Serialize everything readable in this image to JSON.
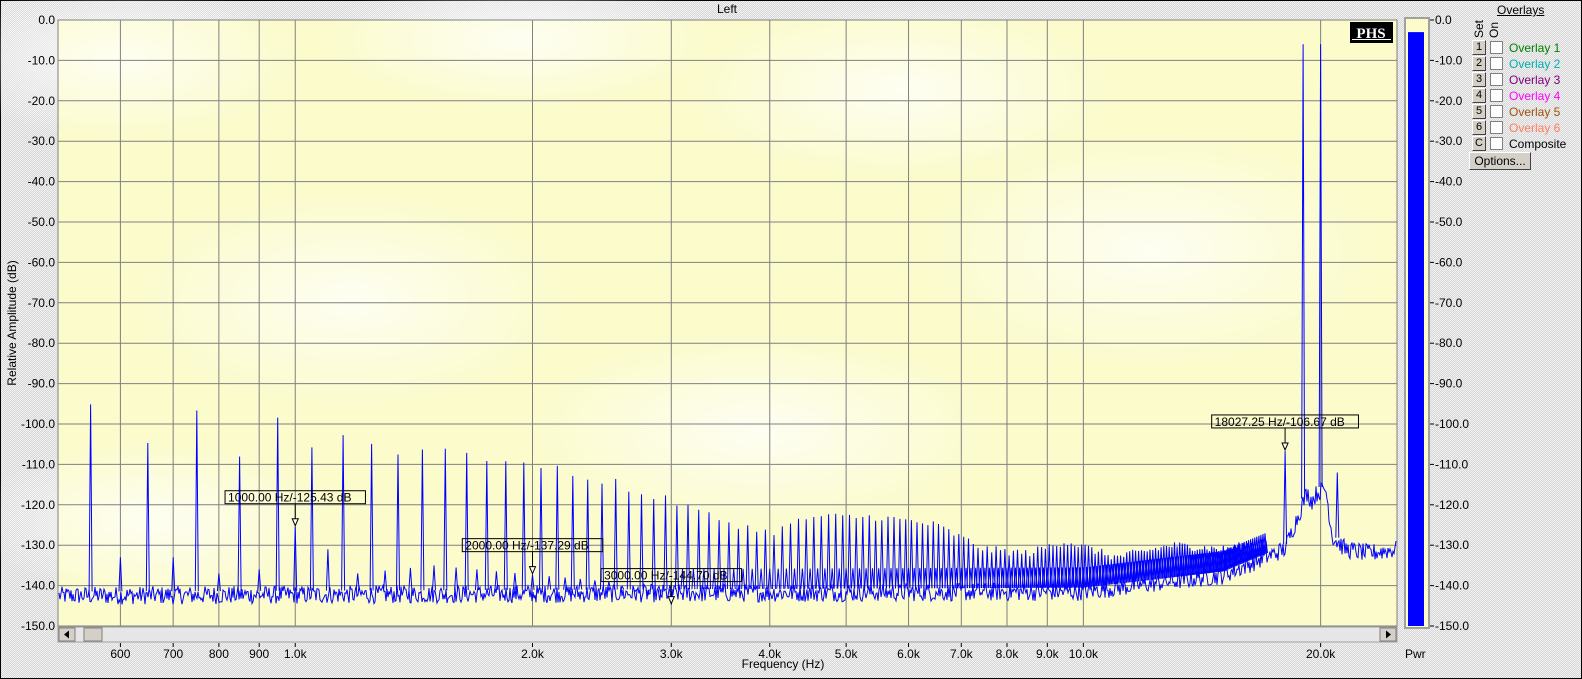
{
  "chart_data": {
    "type": "line",
    "title": "Left",
    "xlabel": "Frequency (Hz)",
    "ylabel": "Relative Amplitude (dB)",
    "xscale": "log",
    "xlim": [
      500,
      25000
    ],
    "ylim": [
      -150,
      0
    ],
    "grid": true,
    "x_ticks": [
      {
        "value": 600,
        "label": "600"
      },
      {
        "value": 700,
        "label": "700"
      },
      {
        "value": 800,
        "label": "800"
      },
      {
        "value": 900,
        "label": "900"
      },
      {
        "value": 1000,
        "label": "1.0k"
      },
      {
        "value": 2000,
        "label": "2.0k"
      },
      {
        "value": 3000,
        "label": "3.0k"
      },
      {
        "value": 4000,
        "label": "4.0k"
      },
      {
        "value": 5000,
        "label": "5.0k"
      },
      {
        "value": 6000,
        "label": "6.0k"
      },
      {
        "value": 7000,
        "label": "7.0k"
      },
      {
        "value": 8000,
        "label": "8.0k"
      },
      {
        "value": 9000,
        "label": "9.0k"
      },
      {
        "value": 10000,
        "label": "10.0k"
      },
      {
        "value": 20000,
        "label": "20.0k"
      }
    ],
    "y_ticks": [
      0,
      -10,
      -20,
      -30,
      -40,
      -50,
      -60,
      -70,
      -80,
      -90,
      -100,
      -110,
      -120,
      -130,
      -140,
      -150
    ],
    "y_tick_labels": [
      "0.0",
      "-10.0",
      "-20.0",
      "-30.0",
      "-40.0",
      "-50.0",
      "-60.0",
      "-70.0",
      "-80.0",
      "-90.0",
      "-100.0",
      "-110.0",
      "-120.0",
      "-130.0",
      "-140.0",
      "-150.0"
    ],
    "series_color": "#0000ff",
    "tones": [
      [
        19000,
        -6.0
      ],
      [
        20000,
        -6.0
      ]
    ],
    "main_comb": {
      "start": 550,
      "step": 100,
      "end": 17050,
      "envelope": [
        [
          550,
          -94.5
        ],
        [
          650,
          -104
        ],
        [
          750,
          -97
        ],
        [
          850,
          -108
        ],
        [
          950,
          -99.4
        ],
        [
          1050,
          -105.5
        ],
        [
          1150,
          -102
        ],
        [
          1250,
          -105.6
        ],
        [
          1350,
          -106.7
        ],
        [
          1450,
          -105.7
        ],
        [
          1550,
          -107
        ],
        [
          1650,
          -106.5
        ],
        [
          1750,
          -109
        ],
        [
          1850,
          -110
        ],
        [
          1950,
          -110
        ],
        [
          2050,
          -110
        ],
        [
          2150,
          -111
        ],
        [
          2250,
          -112
        ],
        [
          2350,
          -113
        ],
        [
          2450,
          -115
        ],
        [
          2550,
          -114
        ],
        [
          2650,
          -116.5
        ],
        [
          3000,
          -119
        ],
        [
          3500,
          -124
        ],
        [
          4000,
          -127
        ],
        [
          4500,
          -123
        ],
        [
          5500,
          -123
        ],
        [
          6500,
          -125
        ],
        [
          7500,
          -131
        ],
        [
          8500,
          -132
        ],
        [
          9500,
          -129
        ],
        [
          11000,
          -133
        ],
        [
          13000,
          -130
        ],
        [
          15000,
          -131
        ],
        [
          17050,
          -129
        ]
      ]
    },
    "secondary_comb": {
      "start": 600,
      "step": 100,
      "end": 3000,
      "envelope": [
        [
          600,
          -133
        ],
        [
          700,
          -133
        ],
        [
          800,
          -137
        ],
        [
          900,
          -136
        ],
        [
          1000,
          -125.43
        ],
        [
          1100,
          -131
        ],
        [
          1200,
          -137
        ],
        [
          1500,
          -135
        ],
        [
          2000,
          -137.29
        ],
        [
          2500,
          -139
        ],
        [
          3000,
          -144.7
        ]
      ]
    },
    "extra_spurs": [
      [
        18027.25,
        -106.67
      ],
      [
        21000,
        -112
      ]
    ],
    "noise_floor": [
      [
        500,
        -142.5
      ],
      [
        10000,
        -141.5
      ],
      [
        15000,
        -137.5
      ],
      [
        18000,
        -131
      ],
      [
        18800,
        -122
      ],
      [
        19200,
        -117
      ],
      [
        19500,
        -119
      ],
      [
        19800,
        -117
      ],
      [
        20300,
        -116
      ],
      [
        20700,
        -128
      ],
      [
        21500,
        -131
      ],
      [
        23000,
        -132
      ],
      [
        25000,
        -131
      ]
    ],
    "markers": [
      {
        "freq": 1000,
        "db": -125.43,
        "label": "1000.00 Hz/-125.43 dB"
      },
      {
        "freq": 2000,
        "db": -137.29,
        "label": "2000.00 Hz/-137.29 dB"
      },
      {
        "freq": 3000,
        "db": -144.7,
        "label": "3000.00 Hz/-144.70 dB"
      },
      {
        "freq": 18027.25,
        "db": -106.67,
        "label": "18027.25 Hz/-106.67 dB"
      }
    ],
    "power_meter": {
      "label": "Pwr",
      "value_db": -3.0,
      "ticks": [
        "0.0",
        "-10.0",
        "-20.0",
        "-30.0",
        "-40.0",
        "-50.0",
        "-60.0",
        "-70.0",
        "-80.0",
        "-90.0",
        "-100.0",
        "-110.0",
        "-120.0",
        "-130.0",
        "-140.0",
        "-150.0"
      ],
      "color": "#0000ff"
    }
  },
  "logo": "PHS",
  "overlays": {
    "title": "Overlays",
    "set_header": "Set",
    "on_header": "On",
    "items": [
      {
        "set": "1",
        "label": "Overlay 1",
        "color": "#008000"
      },
      {
        "set": "2",
        "label": "Overlay 2",
        "color": "#00b0b0"
      },
      {
        "set": "3",
        "label": "Overlay 3",
        "color": "#800080"
      },
      {
        "set": "4",
        "label": "Overlay 4",
        "color": "#ff00ff"
      },
      {
        "set": "5",
        "label": "Overlay 5",
        "color": "#a05010"
      },
      {
        "set": "6",
        "label": "Overlay 6",
        "color": "#ff8060"
      },
      {
        "set": "C",
        "label": "Composite",
        "color": "#000000"
      }
    ],
    "options_label": "Options..."
  }
}
